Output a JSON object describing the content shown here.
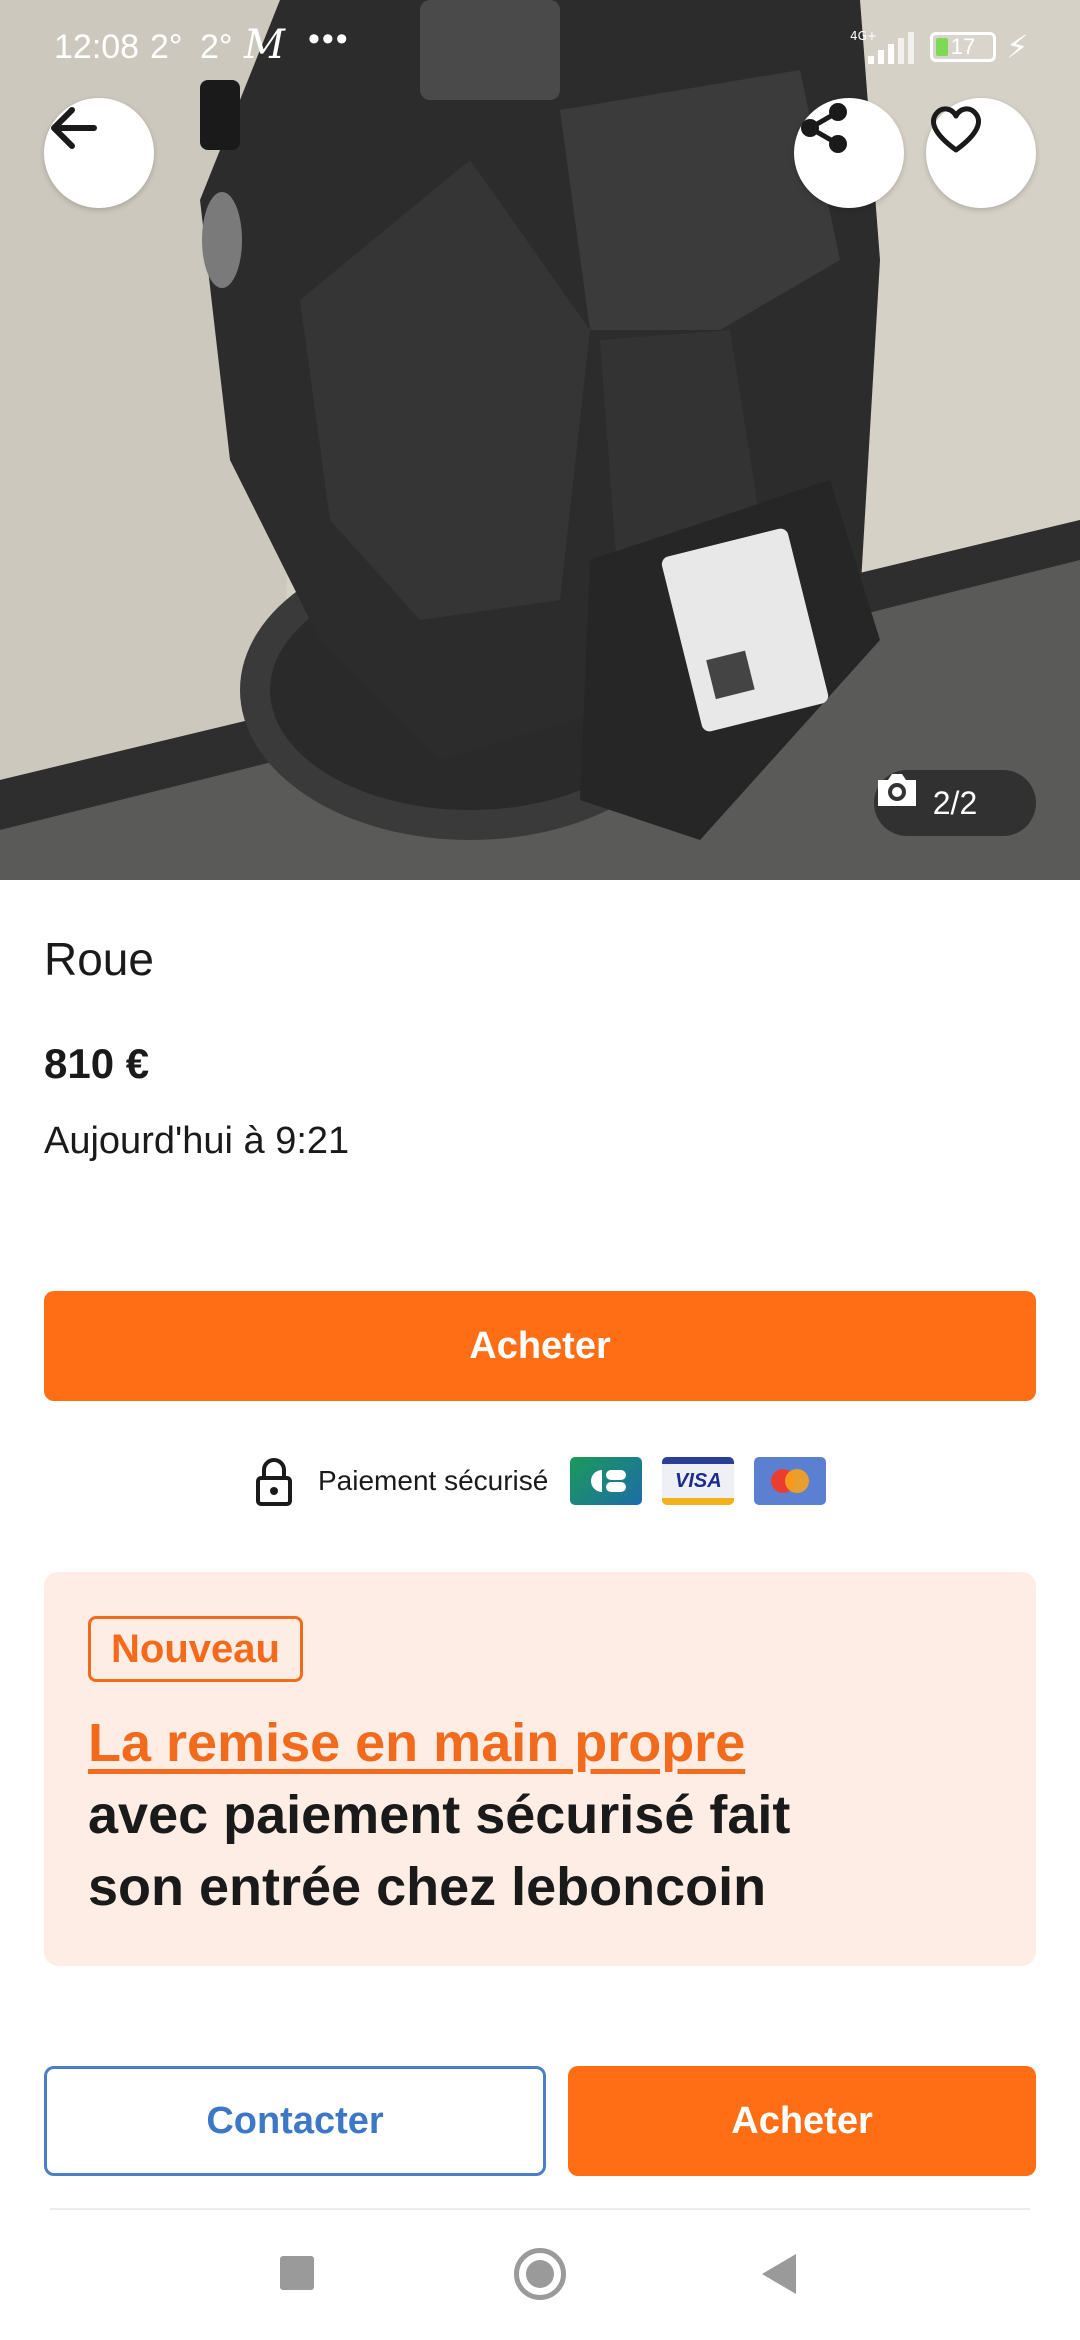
{
  "status_bar": {
    "time": "12:08",
    "temp1": "2°",
    "temp2": "2°",
    "app_logo": "M",
    "more": "•••",
    "network": "4G+",
    "battery": "17"
  },
  "gallery": {
    "counter": "2/2"
  },
  "listing": {
    "title": "Roue",
    "price": "810 €",
    "date": "Aujourd'hui à 9:21"
  },
  "actions": {
    "buy_label": "Acheter",
    "contact_label": "Contacter"
  },
  "payment": {
    "secure_text": "Paiement sécurisé",
    "cards": [
      "cb-card-icon",
      "visa-card-icon",
      "mastercard-card-icon"
    ],
    "visa_text": "VISA"
  },
  "promo": {
    "badge": "Nouveau",
    "headline": "La remise en main propre",
    "line2": "avec paiement sécurisé fait",
    "line3": "son entrée chez leboncoin"
  },
  "colors": {
    "accent_orange": "#ff6e14",
    "promo_bg": "#fdede5",
    "link_blue": "#3d78c6"
  }
}
